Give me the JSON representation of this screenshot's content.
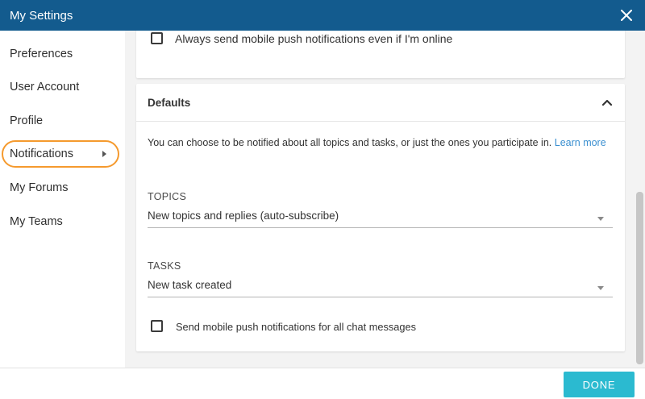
{
  "window": {
    "title": "My Settings",
    "close_icon": "close-icon"
  },
  "sidebar": {
    "items": [
      {
        "label": "Preferences"
      },
      {
        "label": "User Account"
      },
      {
        "label": "Profile"
      },
      {
        "label": "Notifications",
        "active": true
      },
      {
        "label": "My Forums"
      },
      {
        "label": "My Teams"
      }
    ],
    "highlight_color": "#f59a2e"
  },
  "mobile_card": {
    "checkbox_label": "Always send mobile push notifications even if I'm online",
    "checked": false
  },
  "defaults": {
    "title": "Defaults",
    "collapse_icon": "chevron-up-icon",
    "description": "You can choose to be notified about all topics and tasks, or just the ones you participate in.",
    "learn_more": "Learn more",
    "topics": {
      "label": "TOPICS",
      "value": "New topics and replies (auto-subscribe)"
    },
    "tasks": {
      "label": "TASKS",
      "value": "New task created"
    },
    "chat_checkbox_label": "Send mobile push notifications for all chat messages",
    "chat_checked": false
  },
  "footer": {
    "done_label": "DONE"
  },
  "colors": {
    "titlebar": "#135b8e",
    "accent": "#2bbad0",
    "link": "#3a8fd0"
  }
}
